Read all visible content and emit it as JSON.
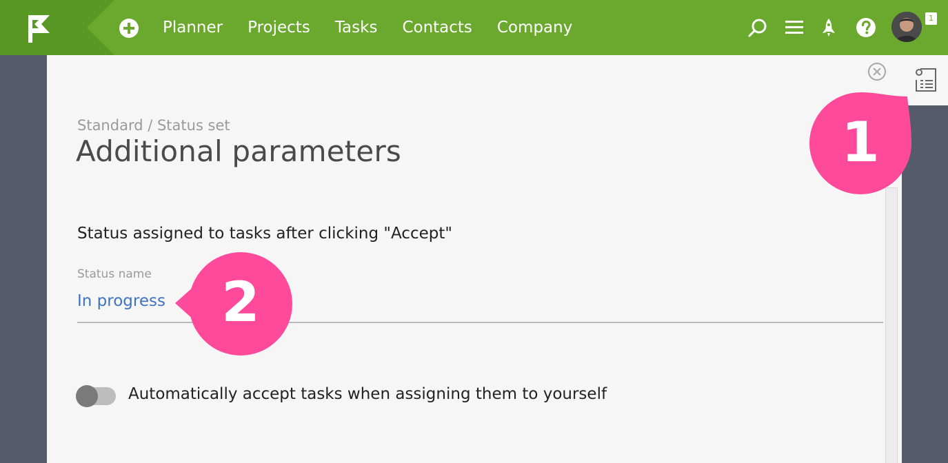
{
  "nav": {
    "items": [
      {
        "label": "Planner"
      },
      {
        "label": "Projects"
      },
      {
        "label": "Tasks"
      },
      {
        "label": "Contacts"
      },
      {
        "label": "Company"
      }
    ],
    "notification_count": "1"
  },
  "panel": {
    "breadcrumb": "Standard / Status set",
    "title": "Additional parameters",
    "section_label": "Status assigned to tasks after clicking \"Accept\"",
    "status_field": {
      "label": "Status name",
      "value": "In progress"
    },
    "auto_accept": {
      "label": "Automatically accept tasks when assigning them to yourself",
      "enabled": false
    }
  },
  "callouts": [
    {
      "number": "1"
    },
    {
      "number": "2"
    }
  ],
  "colors": {
    "brand_green": "#6aa82e",
    "callout_pink": "#ff4a9c",
    "link_blue": "#3f73c0",
    "side_background": "#565b6b"
  },
  "icons": [
    "flag-logo-icon",
    "plus-circle-icon",
    "search-icon",
    "menu-icon",
    "rocket-icon",
    "help-icon",
    "close-circle-icon",
    "settings-list-icon"
  ]
}
